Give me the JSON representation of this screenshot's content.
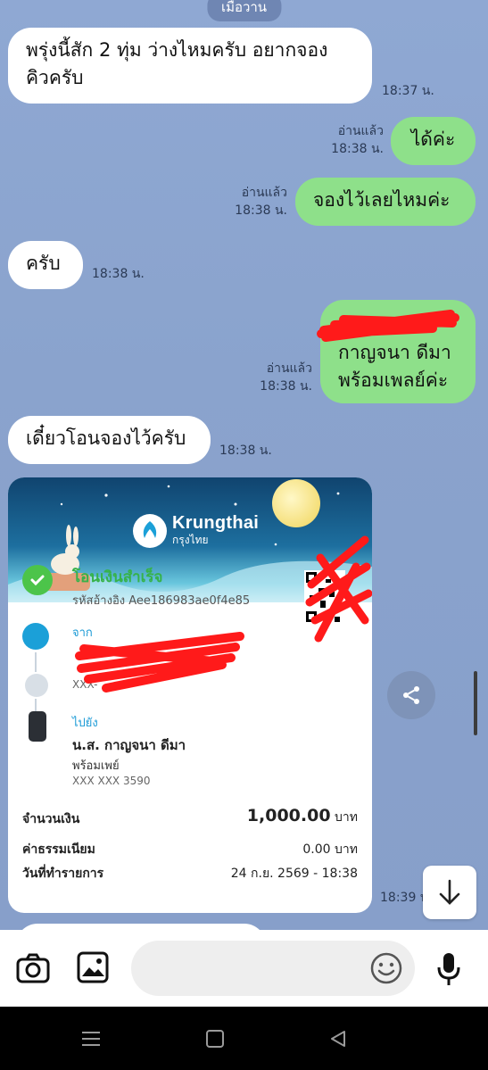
{
  "date_separator": "เมื่อวาน",
  "messages": [
    {
      "side": "in",
      "text_line1": "พรุ่งนี้สัก 2 ทุ่ม ว่างไหมครับ อยากจอง",
      "text_line2": "คิวครับ",
      "time": "18:37 น."
    },
    {
      "side": "out",
      "text": "ได้ค่ะ",
      "read": "อ่านแล้ว",
      "time": "18:38 น."
    },
    {
      "side": "out",
      "text": "จองไว้เลยไหมค่ะ",
      "read": "อ่านแล้ว",
      "time": "18:38 น."
    },
    {
      "side": "in",
      "text": "ครับ",
      "time": "18:38 น."
    },
    {
      "side": "out",
      "text_line1": "กาญจนา ดีมา",
      "text_line2": "พร้อมเพลย์ค่ะ",
      "read": "อ่านแล้ว",
      "time": "18:38 น."
    },
    {
      "side": "in",
      "text": "เดี๋ยวโอนจองไว้ครับ",
      "time": "18:38 น."
    }
  ],
  "receipt": {
    "bank_name": "Krungthai",
    "bank_name_th": "กรุงไทย",
    "status": "โอนเงินสำเร็จ",
    "reference": "รหัสอ้างอิง Aee186983ae0f4e85",
    "from_label": "จาก",
    "from_account": "XXX-",
    "to_label": "ไปยัง",
    "to_name": "น.ส. กาญจนา ดีมา",
    "to_service": "พร้อมเพย์",
    "to_account": "XXX XXX 3590",
    "amount_label": "จำนวนเงิน",
    "amount": "1,000.00",
    "currency": "บาท",
    "fee_label": "ค่าธรรมเนียม",
    "fee": "0.00",
    "date_label": "วันที่ทำรายการ",
    "date": "24 ก.ย. 2569 - 18:38",
    "time": "18:39 น."
  },
  "icons": {
    "share": "share-icon",
    "scroll_down": "arrow-down-icon",
    "camera": "camera-icon",
    "gallery": "image-icon",
    "emoji": "emoji-icon",
    "mic": "microphone-icon"
  },
  "colors": {
    "chat_bg": "#8ca5cf",
    "bubble_out": "#8ee08a",
    "bubble_in": "#ffffff",
    "success_green": "#36b24a",
    "redaction": "#ff1a1a"
  }
}
